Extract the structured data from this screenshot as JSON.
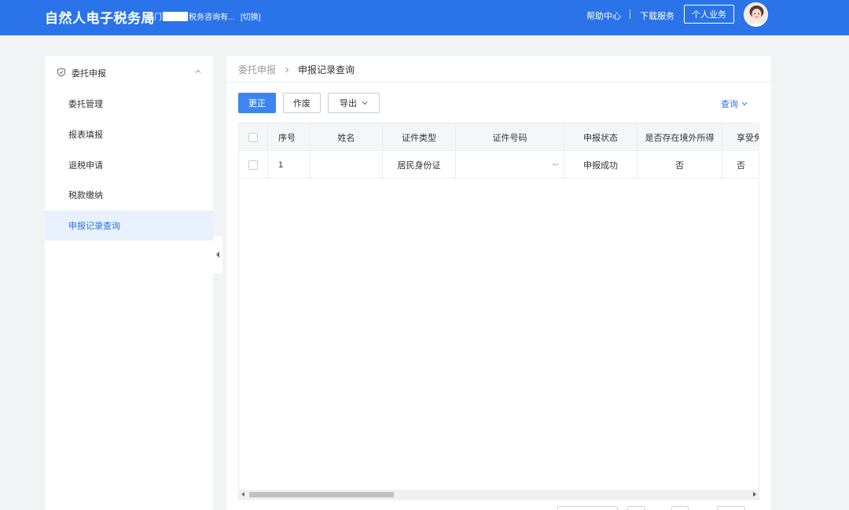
{
  "header": {
    "title": "自然人电子税务局",
    "org_prefix": "厦门",
    "org_suffix": "税务咨询有...",
    "switch_label": "[切换]",
    "help_label": "帮助中心",
    "download_label": "下载服务",
    "personal_label": "个人业务",
    "bg_color": "#2a73e8"
  },
  "sidebar": {
    "group_label": "委托申报",
    "group_icon": "shield-icon",
    "items": [
      {
        "label": "委托管理"
      },
      {
        "label": "报表填报"
      },
      {
        "label": "退税申请"
      },
      {
        "label": "税款缴纳"
      },
      {
        "label": "申报记录查询",
        "active": true
      }
    ]
  },
  "breadcrumb": {
    "parent": "委托申报",
    "current": "申报记录查询"
  },
  "toolbar": {
    "correct_label": "更正",
    "void_label": "作废",
    "export_label": "导出",
    "query_label": "查询"
  },
  "table": {
    "columns": [
      "序号",
      "姓名",
      "证件类型",
      "证件号码",
      "申报状态",
      "是否存在境外所得",
      "享受免"
    ],
    "rows": [
      {
        "index": "1",
        "name": "",
        "id_type": "居民身份证",
        "id_number": "",
        "status": "申报成功",
        "foreign_income": "否",
        "exempt": "否"
      }
    ]
  }
}
